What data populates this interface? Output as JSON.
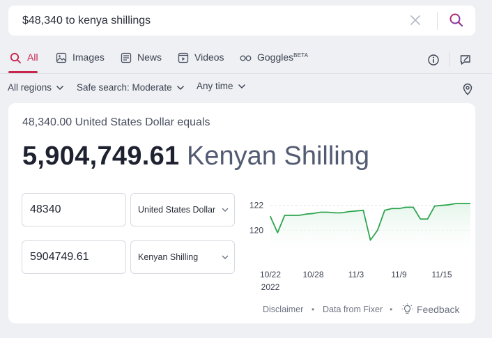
{
  "search": {
    "query": "$48,340 to kenya shillings"
  },
  "tabs": [
    {
      "label": "All",
      "icon": "search-icon",
      "active": true
    },
    {
      "label": "Images",
      "icon": "image-icon"
    },
    {
      "label": "News",
      "icon": "news-icon"
    },
    {
      "label": "Videos",
      "icon": "video-icon"
    },
    {
      "label": "Goggles",
      "badge": "BETA",
      "icon": "goggles-icon"
    }
  ],
  "toolbar_icons": [
    "info-icon",
    "feedback-chat-icon"
  ],
  "filters": {
    "region": "All regions",
    "safe_search": "Safe search: Moderate",
    "time": "Any time"
  },
  "converter": {
    "equals_line": "48,340.00 United States Dollar equals",
    "result_value": "5,904,749.61",
    "result_currency": "Kenyan Shilling",
    "from_amount": "48340",
    "from_currency": "United States Dollar",
    "to_amount": "5904749.61",
    "to_currency": "Kenyan Shilling"
  },
  "chart_data": {
    "type": "area",
    "y_ticks": [
      122,
      120
    ],
    "x_ticks": [
      "10/22",
      "10/28",
      "11/3",
      "11/9",
      "11/15"
    ],
    "x_year": "2022",
    "ylim": [
      118.0,
      122.6
    ],
    "grid": "horizontal dashed at 122 and 120",
    "colors": {
      "line": "#2ea44f",
      "fill": "#e4f5ea"
    },
    "points": [
      [
        "10/22",
        121.1
      ],
      [
        "10/23",
        119.8
      ],
      [
        "10/24",
        121.2
      ],
      [
        "10/25",
        121.2
      ],
      [
        "10/26",
        121.2
      ],
      [
        "10/27",
        121.3
      ],
      [
        "10/28",
        121.35
      ],
      [
        "10/29",
        121.45
      ],
      [
        "10/30",
        121.45
      ],
      [
        "10/31",
        121.4
      ],
      [
        "11/1",
        121.4
      ],
      [
        "11/2",
        121.5
      ],
      [
        "11/3",
        121.55
      ],
      [
        "11/4",
        121.6
      ],
      [
        "11/5",
        119.2
      ],
      [
        "11/6",
        120.0
      ],
      [
        "11/7",
        121.6
      ],
      [
        "11/8",
        121.75
      ],
      [
        "11/9",
        121.75
      ],
      [
        "11/10",
        121.85
      ],
      [
        "11/11",
        121.85
      ],
      [
        "11/12",
        120.9
      ],
      [
        "11/13",
        120.9
      ],
      [
        "11/14",
        121.95
      ],
      [
        "11/15",
        122.0
      ],
      [
        "11/16",
        122.05
      ],
      [
        "11/17",
        122.15
      ],
      [
        "11/18",
        122.15
      ],
      [
        "11/19",
        122.15
      ]
    ]
  },
  "footer": {
    "disclaimer": "Disclaimer",
    "separator": "•",
    "source": "Data from Fixer",
    "feedback": "Feedback"
  }
}
